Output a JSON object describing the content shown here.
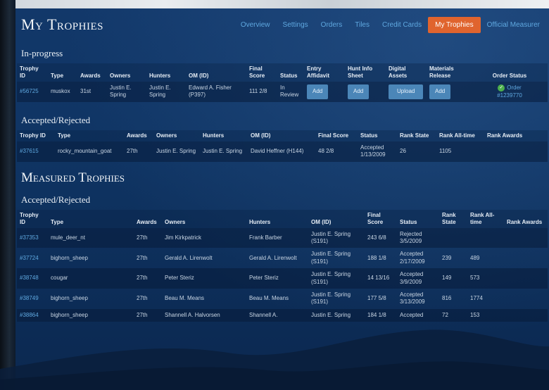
{
  "header": {
    "title": "My Trophies",
    "nav": [
      {
        "label": "Overview",
        "active": false
      },
      {
        "label": "Settings",
        "active": false
      },
      {
        "label": "Orders",
        "active": false
      },
      {
        "label": "Tiles",
        "active": false
      },
      {
        "label": "Credit Cards",
        "active": false
      },
      {
        "label": "My Trophies",
        "active": true
      },
      {
        "label": "Official Measurer",
        "active": false
      }
    ]
  },
  "my_trophies": {
    "in_progress": {
      "title": "In-progress",
      "columns": [
        "Trophy ID",
        "Type",
        "Awards",
        "Owners",
        "Hunters",
        "OM (ID)",
        "Final Score",
        "Status",
        "Entry Affidavit",
        "Hunt Info Sheet",
        "Digital Assets",
        "Materials Release",
        "Order Status"
      ],
      "rows": [
        {
          "id": "#56725",
          "type": "muskox",
          "awards": "31st",
          "owners": "Justin E. Spring",
          "hunters": "Justin E. Spring",
          "om": "Edward A. Fisher (P397)",
          "score": "111 2/8",
          "status": "In Review",
          "affidavit": "Add",
          "hunt_info": "Add",
          "digital": "Upload",
          "materials": "Add",
          "order_link": "Order",
          "order_number": "#1239770"
        }
      ]
    },
    "accepted": {
      "title": "Accepted/Rejected",
      "columns": [
        "Trophy ID",
        "Type",
        "Awards",
        "Owners",
        "Hunters",
        "OM (ID)",
        "Final Score",
        "Status",
        "Rank State",
        "Rank All-time",
        "Rank Awards"
      ],
      "rows": [
        {
          "id": "#37615",
          "type": "rocky_mountain_goat",
          "awards": "27th",
          "owners": "Justin E. Spring",
          "hunters": "Justin E. Spring",
          "om": "David Heffner (H144)",
          "score": "48 2/8",
          "status": "Accepted 1/13/2009",
          "rank_state": "26",
          "rank_alltime": "1105",
          "rank_awards": ""
        }
      ]
    }
  },
  "measured": {
    "title": "Measured Trophies",
    "accepted": {
      "title": "Accepted/Rejected",
      "columns": [
        "Trophy ID",
        "Type",
        "Awards",
        "Owners",
        "Hunters",
        "OM (ID)",
        "Final Score",
        "Status",
        "Rank State",
        "Rank All-time",
        "Rank Awards"
      ],
      "rows": [
        {
          "id": "#37353",
          "type": "mule_deer_nt",
          "awards": "27th",
          "owners": "Jim Kirkpatrick",
          "hunters": "Frank Barber",
          "om": "Justin E. Spring (S191)",
          "score": "243 6/8",
          "status": "Rejected 3/5/2009",
          "rank_state": "",
          "rank_alltime": "",
          "rank_awards": ""
        },
        {
          "id": "#37724",
          "type": "bighorn_sheep",
          "awards": "27th",
          "owners": "Gerald A. Lirenwolt",
          "hunters": "Gerald A. Lirenwolt",
          "om": "Justin E. Spring (S191)",
          "score": "188 1/8",
          "status": "Accepted 2/17/2009",
          "rank_state": "239",
          "rank_alltime": "489",
          "rank_awards": ""
        },
        {
          "id": "#38748",
          "type": "cougar",
          "awards": "27th",
          "owners": "Peter Steriz",
          "hunters": "Peter Steriz",
          "om": "Justin E. Spring (S191)",
          "score": "14 13/16",
          "status": "Accepted 3/9/2009",
          "rank_state": "149",
          "rank_alltime": "573",
          "rank_awards": ""
        },
        {
          "id": "#38749",
          "type": "bighorn_sheep",
          "awards": "27th",
          "owners": "Beau M. Means",
          "hunters": "Beau M. Means",
          "om": "Justin E. Spring (S191)",
          "score": "177 5/8",
          "status": "Accepted 3/13/2009",
          "rank_state": "816",
          "rank_alltime": "1774",
          "rank_awards": ""
        },
        {
          "id": "#38864",
          "type": "bighorn_sheep",
          "awards": "27th",
          "owners": "Shannell A. Halvorsen",
          "hunters": "Shannell A.",
          "om": "Justin E. Spring",
          "score": "184 1/8",
          "status": "Accepted",
          "rank_state": "72",
          "rank_alltime": "153",
          "rank_awards": ""
        }
      ]
    }
  }
}
